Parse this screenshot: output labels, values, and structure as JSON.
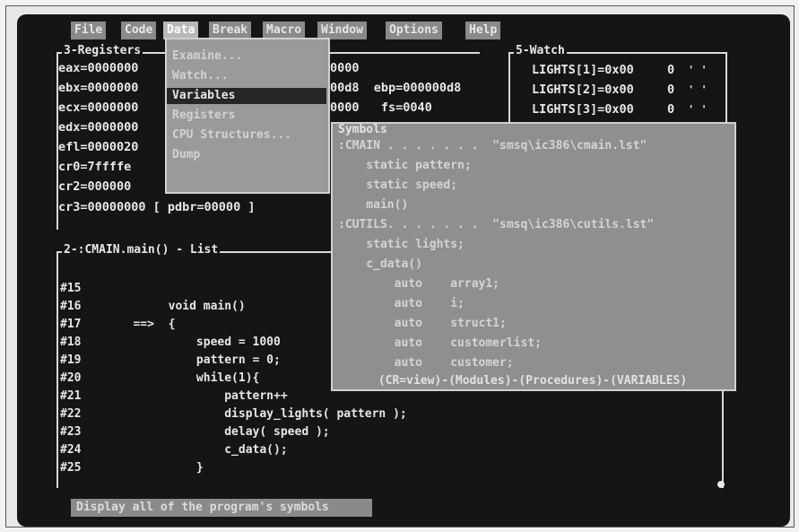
{
  "menu": [
    "File",
    "Code",
    "Data",
    "Break",
    "Macro",
    "Window",
    "Options",
    "Help"
  ],
  "registers": {
    "title": "3-Registers",
    "rows": [
      {
        "left": "eax=0000000",
        "right": "0000"
      },
      {
        "left": "ebx=0000000",
        "right": "00d8  ebp=000000d8"
      },
      {
        "left": "ecx=0000000",
        "right": "0000   fs=0040"
      },
      {
        "left": "edx=0000000",
        "right": ""
      },
      {
        "left": "efl=0000020",
        "right": ""
      },
      {
        "left": "cr0=7ffffe",
        "right": ""
      },
      {
        "left": "cr2=000000",
        "right": ""
      },
      {
        "left": "cr3=00000000 [ pdbr=00000 ]",
        "right": ""
      }
    ]
  },
  "data_menu": {
    "items": [
      "Examine...",
      "Watch...",
      "Variables",
      "Registers",
      "CPU Structures...",
      "Dump"
    ],
    "selected_index": 2
  },
  "watch": {
    "title": "5-Watch",
    "rows": [
      {
        "name": "LIGHTS[1]=0x00",
        "val": "0"
      },
      {
        "name": "LIGHTS[2]=0x00",
        "val": "0"
      },
      {
        "name": "LIGHTS[3]=0x00",
        "val": "0"
      }
    ]
  },
  "symbols": {
    "title": "Symbols",
    "lines": [
      ":CMAIN . . . . . . .  \"smsq\\ic386\\cmain.lst\"",
      "    static pattern;",
      "    static speed;",
      "    main()",
      ":CUTILS. . . . . . .  \"smsq\\ic386\\cutils.lst\"",
      "    static lights;",
      "    c_data()",
      "        auto    array1;",
      "        auto    i;",
      "        auto    struct1;",
      "        auto    customerlist;",
      "        auto    customer;"
    ],
    "footer": "(CR=view)-(Modules)-(Procedures)-(VARIABLES)"
  },
  "list": {
    "title": "2-:CMAIN.main() - List",
    "lines": [
      {
        "num": "#15",
        "code": ""
      },
      {
        "num": "#16",
        "code": "        void main()"
      },
      {
        "num": "#17",
        "code": "   ==>  {"
      },
      {
        "num": "#18",
        "code": "            speed = 1000"
      },
      {
        "num": "#19",
        "code": "            pattern = 0;"
      },
      {
        "num": "#20",
        "code": "            while(1){"
      },
      {
        "num": "#21",
        "code": "                pattern++"
      },
      {
        "num": "#22",
        "code": "                display_lights( pattern );"
      },
      {
        "num": "#23",
        "code": "                delay( speed );"
      },
      {
        "num": "#24",
        "code": "                c_data();"
      },
      {
        "num": "#25",
        "code": "            }"
      }
    ]
  },
  "status": "Display all of the program's symbols"
}
